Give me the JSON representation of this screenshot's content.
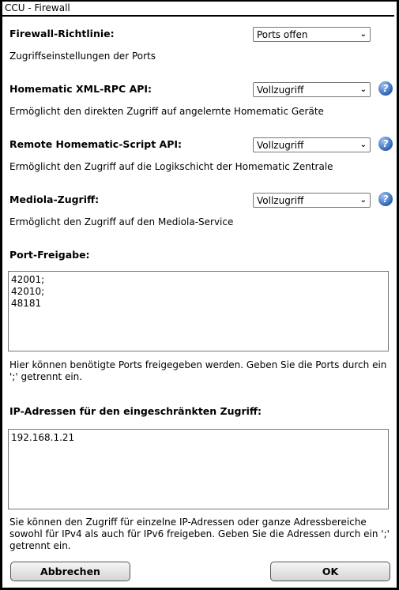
{
  "window": {
    "title": "CCU - Firewall"
  },
  "sections": [
    {
      "label": "Firewall-Richtlinie:",
      "select": "Ports offen",
      "description": "Zugriffseinstellungen der Ports",
      "help": false
    },
    {
      "label": "Homematic XML-RPC API:",
      "select": "Vollzugriff",
      "description": "Ermöglicht den direkten Zugriff auf angelernte Homematic Geräte",
      "help": true
    },
    {
      "label": "Remote Homematic-Script API:",
      "select": "Vollzugriff",
      "description": "Ermöglicht den Zugriff auf die Logikschicht der Homematic Zentrale",
      "help": true
    },
    {
      "label": "Mediola-Zugriff:",
      "select": "Vollzugriff",
      "description": "Ermöglicht den Zugriff auf den Mediola-Service",
      "help": true
    }
  ],
  "ports": {
    "label": "Port-Freigabe:",
    "value": "42001;\n42010;\n48181",
    "hint": "Hier können benötigte Ports freigegeben werden. Geben Sie die Ports durch ein ';' getrennt ein."
  },
  "ips": {
    "label": "IP-Adressen für den eingeschränkten Zugriff:",
    "value": "192.168.1.21",
    "hint": "Sie können den Zugriff für einzelne IP-Adressen oder ganze Adressbereiche sowohl für IPv4 als auch für IPv6 freigeben. Geben Sie die Adressen durch ein ';' getrennt ein."
  },
  "buttons": {
    "cancel": "Abbrechen",
    "ok": "OK"
  },
  "help_icon": "question-mark-icon"
}
